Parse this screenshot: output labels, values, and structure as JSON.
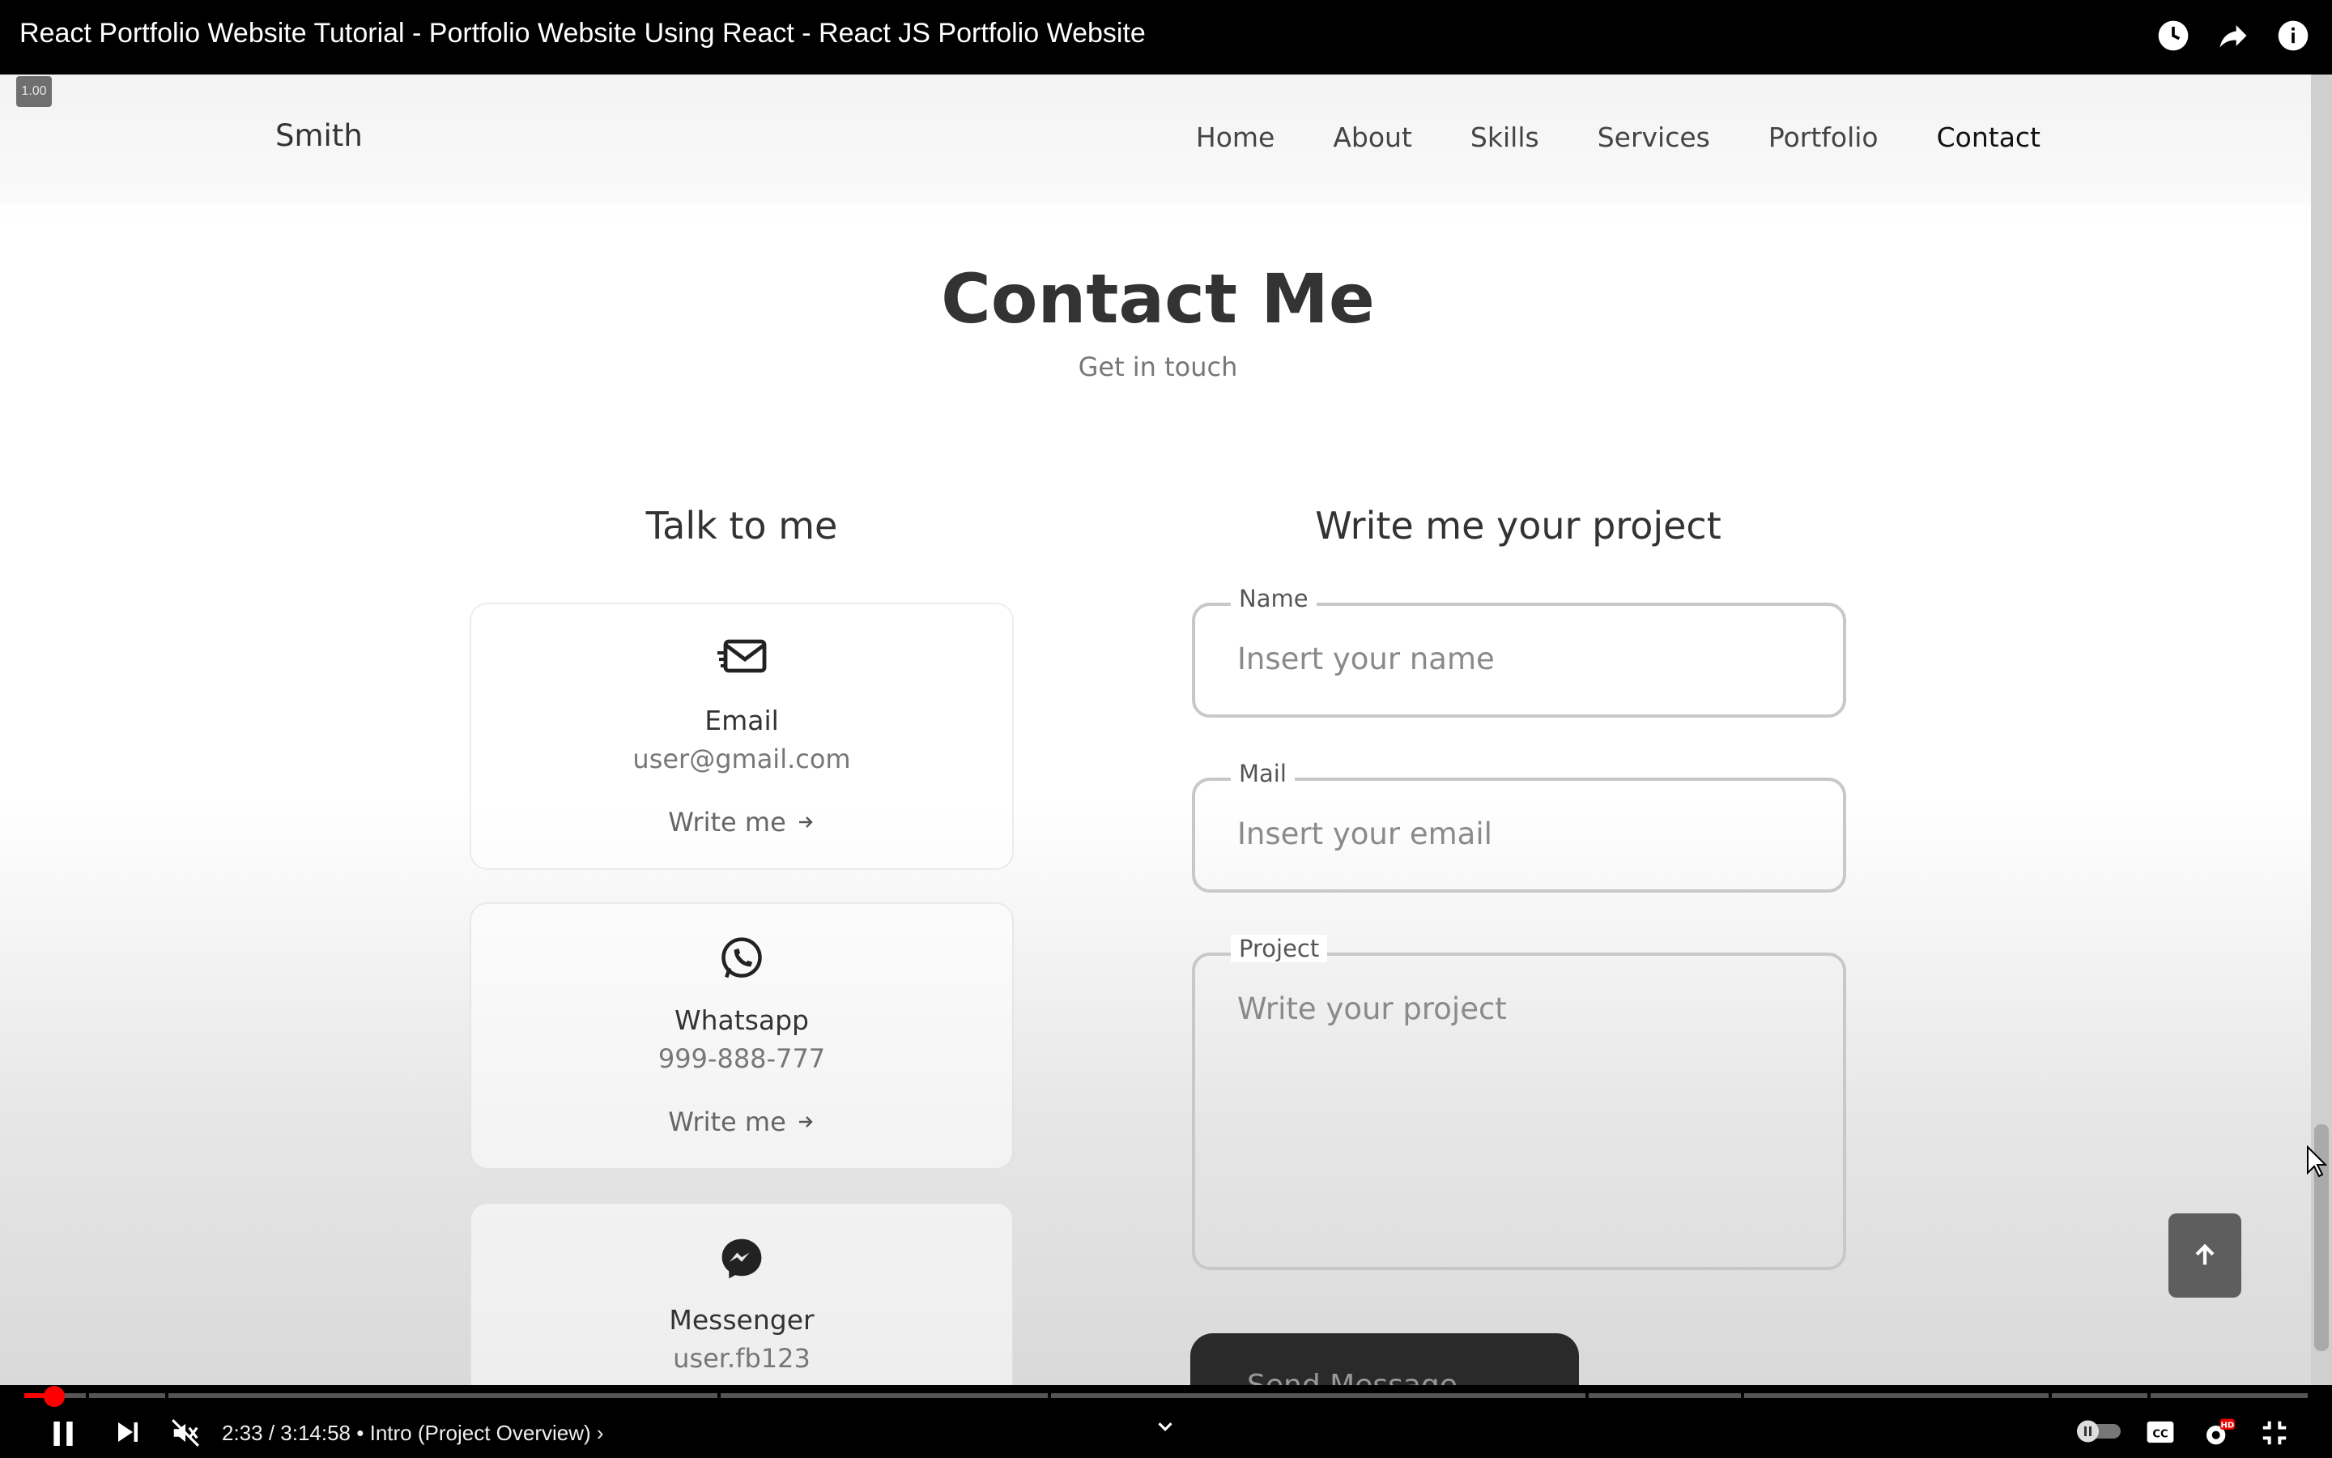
{
  "player": {
    "video_title": "React Portfolio Website Tutorial - Portfolio Website Using React - React JS Portfolio Website",
    "speed": "1.00",
    "time": "2:33 / 3:14:58",
    "chapter": "• Intro (Project Overview) ›"
  },
  "site": {
    "logo": "Smith",
    "nav": [
      {
        "label": "Home"
      },
      {
        "label": "About"
      },
      {
        "label": "Skills"
      },
      {
        "label": "Services"
      },
      {
        "label": "Portfolio"
      },
      {
        "label": "Contact"
      }
    ],
    "section_title": "Contact Me",
    "section_subtitle": "Get in touch",
    "talk_title": "Talk to me",
    "write_title": "Write me your project",
    "cards": [
      {
        "icon": "email-icon",
        "title": "Email",
        "value": "user@gmail.com",
        "link": "Write me"
      },
      {
        "icon": "whatsapp-icon",
        "title": "Whatsapp",
        "value": "999-888-777",
        "link": "Write me"
      },
      {
        "icon": "messenger-icon",
        "title": "Messenger",
        "value": "user.fb123"
      }
    ],
    "form": {
      "name_label": "Name",
      "name_placeholder": "Insert your name",
      "mail_label": "Mail",
      "mail_placeholder": "Insert your email",
      "project_label": "Project",
      "project_placeholder": "Write your project",
      "send_label": "Send Message"
    }
  },
  "colors": {
    "progress": "#ff0000",
    "button_dark": "#2a2a2a"
  }
}
